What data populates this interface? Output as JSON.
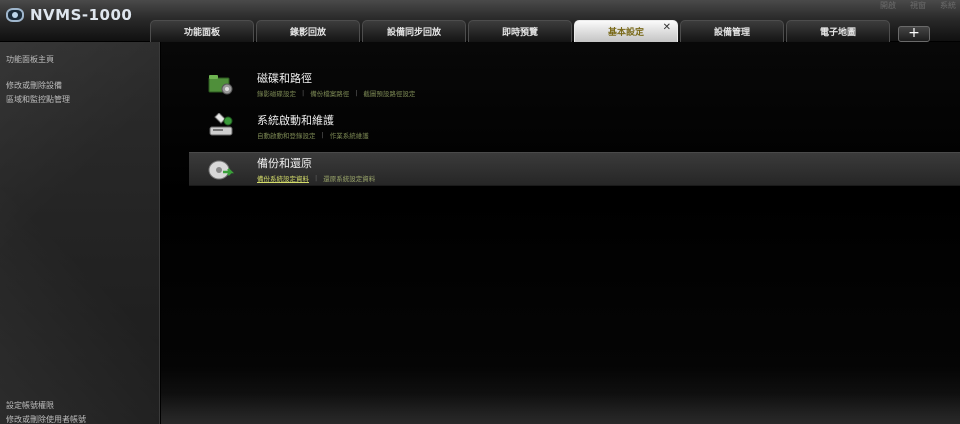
{
  "app": {
    "title": "NVMS-1000"
  },
  "system_menu": [
    "開啟",
    "視窗",
    "系統"
  ],
  "tabs": [
    {
      "label": "功能面板"
    },
    {
      "label": "錄影回放"
    },
    {
      "label": "設備同步回放"
    },
    {
      "label": "即時預覽"
    },
    {
      "label": "基本設定",
      "active": true
    },
    {
      "label": "設備管理"
    },
    {
      "label": "電子地圖"
    }
  ],
  "tab_close_glyph": "✕",
  "tab_add_glyph": "+",
  "sidebar": {
    "top_items": [
      {
        "label": "功能面板主頁"
      },
      {
        "label": "修改或刪除設備"
      },
      {
        "label": "區域和監控點管理"
      }
    ],
    "bottom_items": [
      {
        "label": "設定帳號權限"
      },
      {
        "label": "修改或刪除使用者帳號"
      }
    ]
  },
  "main": {
    "cards": [
      {
        "title": "磁碟和路徑",
        "icon": "disk-folder-icon",
        "links": [
          "錄影磁碟設定",
          "備份檔案路徑",
          "截圖預設路徑設定"
        ]
      },
      {
        "title": "系統啟動和維護",
        "icon": "system-maintenance-icon",
        "links": [
          "自動啟動和登錄設定",
          "作業系統維護"
        ]
      },
      {
        "title": "備份和還原",
        "icon": "backup-restore-icon",
        "highlighted": true,
        "links": [
          "備份系統設定資料",
          "還原系統設定資料"
        ],
        "active_link": 0
      }
    ]
  },
  "colors": {
    "active_tab_bg": "#e6e6e6",
    "active_tab_text": "#7a6a1a",
    "link_color": "#7d8a55",
    "active_link_color": "#d4dc6a"
  }
}
